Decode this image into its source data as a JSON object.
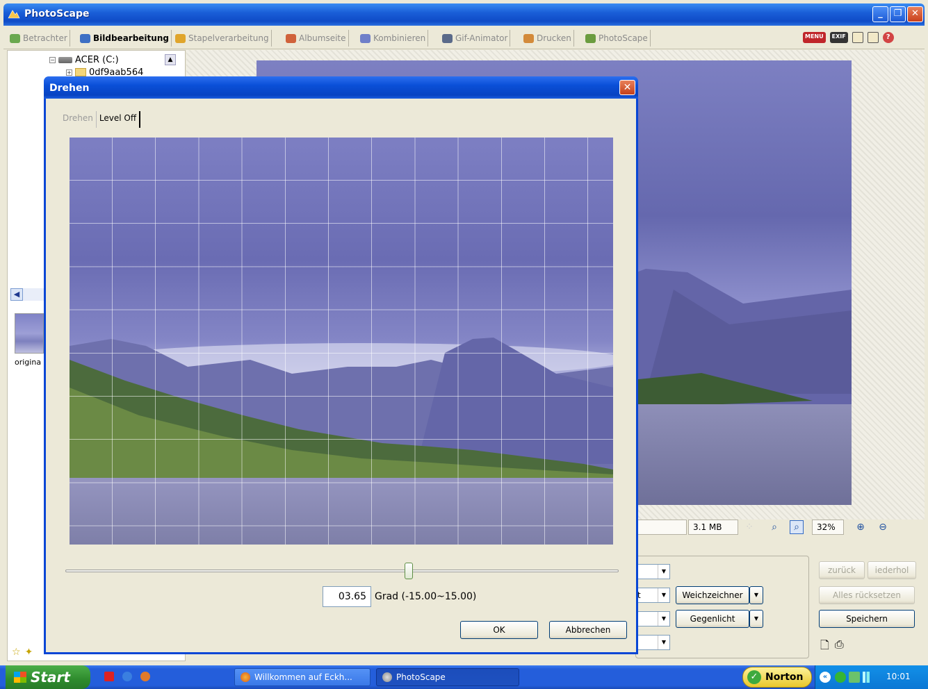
{
  "app": {
    "title": "PhotoScape"
  },
  "toolbar": {
    "tabs": [
      {
        "label": "Betrachter",
        "active": false
      },
      {
        "label": "Bildbearbeitung",
        "active": true
      },
      {
        "label": "Stapelverarbeitung",
        "active": false
      },
      {
        "label": "Albumseite",
        "active": false
      },
      {
        "label": "Kombinieren",
        "active": false
      },
      {
        "label": "Gif-Animator",
        "active": false
      },
      {
        "label": "Drucken",
        "active": false
      },
      {
        "label": "PhotoScape",
        "active": false
      }
    ],
    "menu_badge": "MENU",
    "exif_badge": "EXIF",
    "help_glyph": "?"
  },
  "tree": {
    "drive_label": "ACER (C:)",
    "folder_label": "0df9aab564"
  },
  "thumbnail": {
    "label": "origina"
  },
  "status": {
    "file_size": "3.1 MB",
    "zoom": "32%"
  },
  "edit_panel": {
    "combo_partial": "t",
    "weichzeichner": "Weichzeichner",
    "gegenlicht": "Gegenlicht",
    "undo": "zurück",
    "redo": "iederhol",
    "reset_all": "Alles rücksetzen",
    "save": "Speichern"
  },
  "dialog": {
    "title": "Drehen",
    "close_glyph": "✕",
    "tabs": [
      {
        "label": "Drehen",
        "active": false
      },
      {
        "label": "Level Off",
        "active": true
      }
    ],
    "degrees_value": "03.65",
    "degrees_range_label": "Grad (-15.00~15.00)",
    "rotation_fraction": 0.62,
    "ok_label": "OK",
    "cancel_label": "Abbrechen"
  },
  "taskbar": {
    "start_label": "Start",
    "tasks": [
      {
        "label": "Willkommen auf Eckh...",
        "active": false
      },
      {
        "label": "PhotoScape",
        "active": true
      }
    ],
    "norton_label": "Norton",
    "clock": "10:01"
  }
}
